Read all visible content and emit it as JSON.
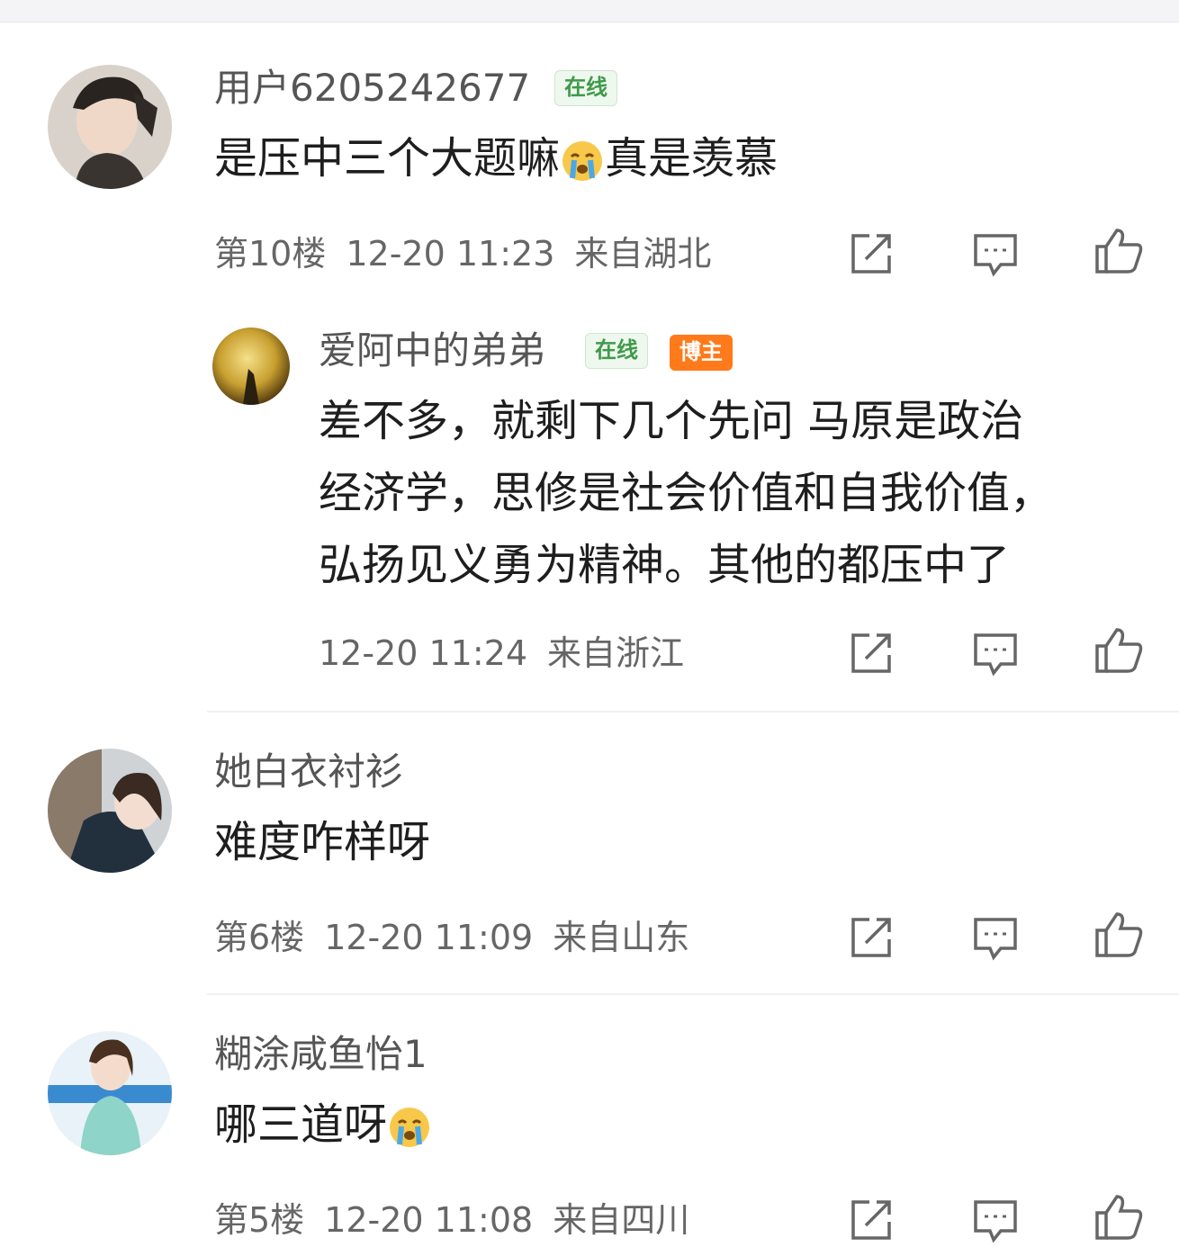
{
  "comments": [
    {
      "username": "用户6205242677",
      "badges": [
        "在线"
      ],
      "text_before": "是压中三个大题嘛",
      "emoji": "crying-face-icon",
      "text_after": "真是羡慕",
      "floor": "第10楼",
      "time": "12-20 11:23",
      "location": "来自湖北",
      "reply": {
        "username": "爱阿中的弟弟",
        "badges": [
          "在线",
          "博主"
        ],
        "lines": [
          "差不多，就剩下几个先问 马原是政治",
          "经济学，思修是社会价值和自我价值，",
          "弘扬见义勇为精神。其他的都压中了"
        ],
        "time": "12-20 11:24",
        "location": "来自浙江"
      }
    },
    {
      "username": "她白衣衬衫",
      "text": "难度咋样呀",
      "floor": "第6楼",
      "time": "12-20 11:09",
      "location": "来自山东"
    },
    {
      "username": "糊涂咸鱼怡1",
      "text_before": "哪三道呀",
      "emoji": "crying-face-icon",
      "floor": "第5楼",
      "time": "12-20 11:08",
      "location": "来自四川"
    }
  ],
  "actions": [
    "share-icon",
    "comment-icon",
    "like-icon"
  ],
  "colors": {
    "online_badge_bg": "#eef8ee",
    "online_badge_text": "#3f9a4a",
    "blogger_badge_bg": "#ff7a1a",
    "meta_text": "#666666"
  }
}
